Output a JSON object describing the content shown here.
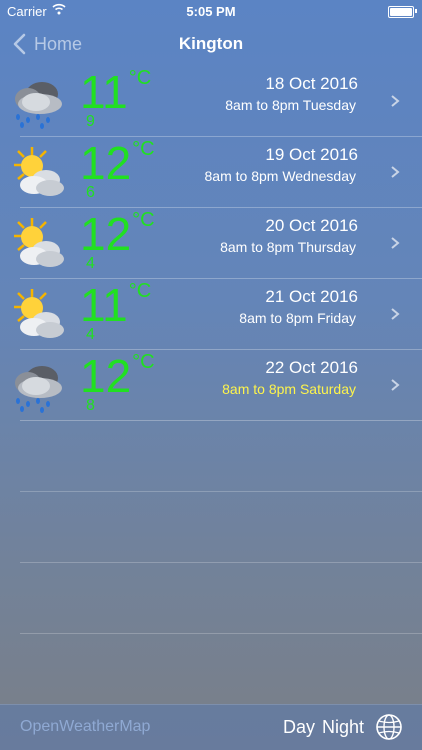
{
  "status_bar": {
    "carrier": "Carrier",
    "time": "5:05 PM"
  },
  "nav": {
    "back_label": "Home",
    "title": "Kington"
  },
  "forecast": [
    {
      "icon": "rain-cloud-icon",
      "temp": "11",
      "unit": "°C",
      "low": "9",
      "date": "18 Oct 2016",
      "period": "8am to 8pm Tuesday",
      "highlight": false
    },
    {
      "icon": "sun-cloud-icon",
      "temp": "12",
      "unit": "°C",
      "low": "6",
      "date": "19 Oct 2016",
      "period": "8am to 8pm Wednesday",
      "highlight": false
    },
    {
      "icon": "sun-cloud-icon",
      "temp": "12",
      "unit": "°C",
      "low": "4",
      "date": "20 Oct 2016",
      "period": "8am to 8pm Thursday",
      "highlight": false
    },
    {
      "icon": "sun-cloud-icon",
      "temp": "11",
      "unit": "°C",
      "low": "4",
      "date": "21 Oct 2016",
      "period": "8am to 8pm Friday",
      "highlight": false
    },
    {
      "icon": "rain-cloud-icon",
      "temp": "12",
      "unit": "°C",
      "low": "8",
      "date": "22 Oct 2016",
      "period": "8am to 8pm Saturday",
      "highlight": true
    }
  ],
  "toolbar": {
    "source_label": "OpenWeatherMap",
    "day_label": "Day",
    "night_label": "Night"
  },
  "colors": {
    "temp": "#21e021",
    "highlight": "#fdf44c"
  }
}
